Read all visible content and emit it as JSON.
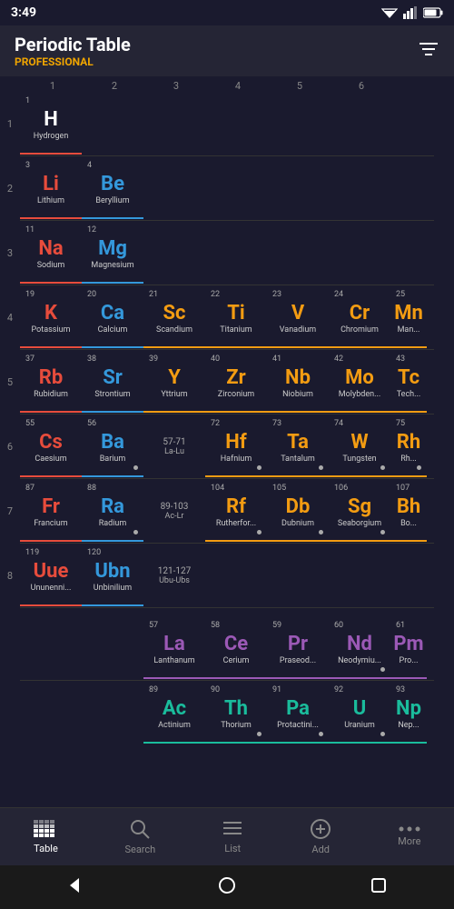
{
  "app": {
    "title": "Periodic Table",
    "subtitle": "PROFESSIONAL",
    "time": "3:49"
  },
  "columns": [
    "1",
    "2",
    "3",
    "4",
    "5",
    "6"
  ],
  "nav": {
    "items": [
      {
        "label": "Table",
        "icon": "⊞",
        "active": true
      },
      {
        "label": "Search",
        "icon": "🔍",
        "active": false
      },
      {
        "label": "List",
        "icon": "≡",
        "active": false
      },
      {
        "label": "Add",
        "icon": "⊕",
        "active": false
      },
      {
        "label": "More",
        "icon": "···",
        "active": false
      }
    ]
  },
  "rows": [
    {
      "num": "1",
      "cells": [
        {
          "atomic": "1",
          "symbol": "H",
          "name": "Hydrogen",
          "category": "hydrogen-el",
          "col": 1
        },
        null,
        null,
        null,
        null,
        null
      ]
    },
    {
      "num": "2",
      "cells": [
        {
          "atomic": "3",
          "symbol": "Li",
          "name": "Lithium",
          "category": "alkali",
          "col": 1
        },
        {
          "atomic": "4",
          "symbol": "Be",
          "name": "Beryllium",
          "category": "alkaline",
          "col": 2
        },
        null,
        null,
        null,
        null
      ]
    },
    {
      "num": "3",
      "cells": [
        {
          "atomic": "11",
          "symbol": "Na",
          "name": "Sodium",
          "category": "alkali",
          "col": 1
        },
        {
          "atomic": "12",
          "symbol": "Mg",
          "name": "Magnesium",
          "category": "alkaline",
          "col": 2
        },
        null,
        null,
        null,
        null
      ]
    },
    {
      "num": "4",
      "cells": [
        {
          "atomic": "19",
          "symbol": "K",
          "name": "Potassium",
          "category": "alkali",
          "col": 1
        },
        {
          "atomic": "20",
          "symbol": "Ca",
          "name": "Calcium",
          "category": "alkaline",
          "col": 2
        },
        {
          "atomic": "21",
          "symbol": "Sc",
          "name": "Scandium",
          "category": "transition",
          "col": 3
        },
        {
          "atomic": "22",
          "symbol": "Ti",
          "name": "Titanium",
          "category": "transition",
          "col": 4
        },
        {
          "atomic": "23",
          "symbol": "V",
          "name": "Vanadium",
          "category": "transition",
          "col": 5
        },
        {
          "atomic": "24",
          "symbol": "Cr",
          "name": "Chromium",
          "category": "transition",
          "col": 6
        },
        {
          "atomic": "25",
          "symbol": "Mn",
          "name": "Mang...",
          "category": "transition",
          "col": 7,
          "partial": true
        }
      ]
    },
    {
      "num": "5",
      "cells": [
        {
          "atomic": "37",
          "symbol": "Rb",
          "name": "Rubidium",
          "category": "alkali",
          "col": 1
        },
        {
          "atomic": "38",
          "symbol": "Sr",
          "name": "Strontium",
          "category": "alkaline",
          "col": 2
        },
        {
          "atomic": "39",
          "symbol": "Y",
          "name": "Yttrium",
          "category": "transition",
          "col": 3
        },
        {
          "atomic": "40",
          "symbol": "Zr",
          "name": "Zirconium",
          "category": "transition",
          "col": 4
        },
        {
          "atomic": "41",
          "symbol": "Nb",
          "name": "Niobium",
          "category": "transition",
          "col": 5
        },
        {
          "atomic": "42",
          "symbol": "Mo",
          "name": "Molybden...",
          "category": "transition",
          "col": 6
        },
        {
          "atomic": "43",
          "symbol": "Tc",
          "name": "Tech...",
          "category": "transition",
          "col": 7,
          "partial": true
        }
      ]
    },
    {
      "num": "6",
      "cells": [
        {
          "atomic": "55",
          "symbol": "Cs",
          "name": "Caesium",
          "category": "alkali",
          "col": 1
        },
        {
          "atomic": "56",
          "symbol": "Ba",
          "name": "Barium",
          "category": "alkaline",
          "col": 2,
          "dot": true
        },
        {
          "span": "57-71",
          "abbr": "La-Lu",
          "col": 3
        },
        {
          "atomic": "72",
          "symbol": "Hf",
          "name": "Hafnium",
          "category": "transition",
          "col": 4,
          "dot": true
        },
        {
          "atomic": "73",
          "symbol": "Ta",
          "name": "Tantalum",
          "category": "transition",
          "col": 5,
          "dot": true
        },
        {
          "atomic": "74",
          "symbol": "W",
          "name": "Tungsten",
          "category": "transition",
          "col": 6,
          "dot": true
        },
        {
          "atomic": "75",
          "symbol": "Rh",
          "name": "Rh...",
          "category": "transition",
          "col": 7,
          "partial": true,
          "dot": true
        }
      ]
    },
    {
      "num": "7",
      "cells": [
        {
          "atomic": "87",
          "symbol": "Fr",
          "name": "Francium",
          "category": "alkali",
          "col": 1
        },
        {
          "atomic": "88",
          "symbol": "Ra",
          "name": "Radium",
          "category": "alkaline",
          "col": 2,
          "dot": true
        },
        {
          "span": "89-103",
          "abbr": "Ac-Lr",
          "col": 3
        },
        {
          "atomic": "104",
          "symbol": "Rf",
          "name": "Rutherfor...",
          "category": "transition",
          "col": 4,
          "dot": true
        },
        {
          "atomic": "105",
          "symbol": "Db",
          "name": "Dubnium",
          "category": "transition",
          "col": 5,
          "dot": true
        },
        {
          "atomic": "106",
          "symbol": "Sg",
          "name": "Seaborgium",
          "category": "transition",
          "col": 6,
          "dot": true
        },
        {
          "atomic": "107",
          "symbol": "Bh",
          "name": "Bo...",
          "category": "transition",
          "col": 7,
          "partial": true
        }
      ]
    },
    {
      "num": "8",
      "cells": [
        {
          "atomic": "119",
          "symbol": "Uue",
          "name": "Ununenni...",
          "category": "alkali",
          "col": 1
        },
        {
          "atomic": "120",
          "symbol": "Ubn",
          "name": "Unbinilium",
          "category": "alkaline",
          "col": 2
        },
        {
          "span": "121-127",
          "abbr": "Ubu-Ubs",
          "col": 3
        },
        null,
        null,
        null,
        null
      ]
    }
  ],
  "lanthanides": [
    {
      "atomic": "57",
      "symbol": "La",
      "name": "Lanthanum",
      "category": "lanthanide"
    },
    {
      "atomic": "58",
      "symbol": "Ce",
      "name": "Cerium",
      "category": "lanthanide"
    },
    {
      "atomic": "59",
      "symbol": "Pr",
      "name": "Praseod...",
      "category": "lanthanide"
    },
    {
      "atomic": "60",
      "symbol": "Nd",
      "name": "Neodymiu...",
      "category": "lanthanide",
      "dot": true
    },
    {
      "atomic": "61",
      "symbol": "Pm",
      "name": "Pro...",
      "category": "lanthanide",
      "partial": true
    }
  ],
  "actinides": [
    {
      "atomic": "89",
      "symbol": "Ac",
      "name": "Actinium",
      "category": "actinide"
    },
    {
      "atomic": "90",
      "symbol": "Th",
      "name": "Thorium",
      "category": "actinide",
      "dot": true
    },
    {
      "atomic": "91",
      "symbol": "Pa",
      "name": "Protactini...",
      "category": "actinide",
      "dot": true
    },
    {
      "atomic": "92",
      "symbol": "U",
      "name": "Uranium",
      "category": "actinide",
      "dot": true
    },
    {
      "atomic": "93",
      "symbol": "Np",
      "name": "Nep...",
      "category": "actinide",
      "partial": true
    }
  ]
}
